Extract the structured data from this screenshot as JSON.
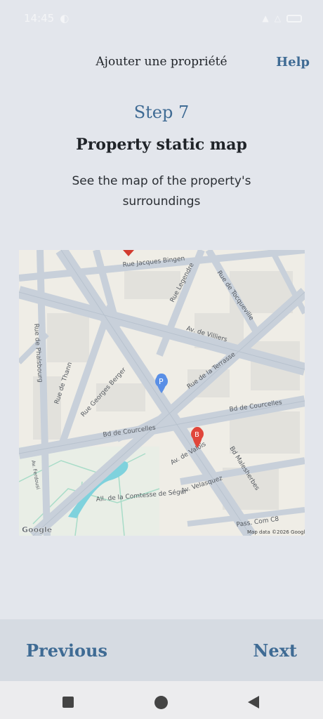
{
  "status_bar": {
    "time": "14:45"
  },
  "header": {
    "title": "Ajouter une propriété",
    "help_label": "Help"
  },
  "step": {
    "label": "Step 7",
    "title": "Property static map",
    "description": "See the map of the property's surroundings"
  },
  "map": {
    "streets": [
      "Rue Jacques Bingen",
      "Rue Legendre",
      "Rue de Tocqueville",
      "Av. de Villiers",
      "Rue de Phalsbourg",
      "Rue de Thann",
      "Rue Georges Berger",
      "Rue de la Terrasse",
      "Bd de Courcelles",
      "Bd de Courcelles",
      "Av. de Valois",
      "Bd Malesherbes",
      "Av. Velasquez",
      "All. de la Comtesse de Ségur",
      "Av. Ferdousi",
      "Pass. Com C8"
    ],
    "markers": {
      "parking_label": "P",
      "pin_b_label": "B"
    },
    "attribution": "Map data ©2026 Google",
    "logo": "Google"
  },
  "navigation": {
    "previous_label": "Previous",
    "next_label": "Next"
  }
}
